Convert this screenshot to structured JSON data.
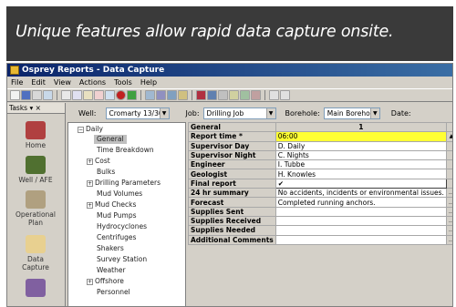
{
  "banner": {
    "caption": "Unique features allow rapid data capture onsite."
  },
  "window": {
    "title": "Osprey Reports - Data Capture"
  },
  "menu": [
    "File",
    "Edit",
    "View",
    "Actions",
    "Tools",
    "Help"
  ],
  "sidebar": {
    "header": "Tasks",
    "items": [
      {
        "label": "Home",
        "icon": "home-icon"
      },
      {
        "label": "Well / AFE",
        "icon": "well-icon"
      },
      {
        "label": "Operational Plan",
        "icon": "plan-icon"
      },
      {
        "label": "Data Capture",
        "icon": "data-capture-icon"
      },
      {
        "label": "",
        "icon": "report-icon"
      }
    ]
  },
  "filters": {
    "well_label": "Well:",
    "well_value": "Cromarty 13/30a",
    "job_label": "Job:",
    "job_value": "Drilling Job",
    "borehole_label": "Borehole:",
    "borehole_value": "Main Borehole",
    "date_label": "Date:"
  },
  "tree": {
    "root": "Daily",
    "items": [
      {
        "label": "General",
        "selected": true,
        "expandable": false
      },
      {
        "label": "Time Breakdown",
        "expandable": false
      },
      {
        "label": "Cost",
        "expandable": true
      },
      {
        "label": "Bulks",
        "expandable": false
      },
      {
        "label": "Drilling Parameters",
        "expandable": true
      },
      {
        "label": "Mud Volumes",
        "expandable": false
      },
      {
        "label": "Mud Checks",
        "expandable": true
      },
      {
        "label": "Mud Pumps",
        "expandable": false
      },
      {
        "label": "Hydrocyclones",
        "expandable": false
      },
      {
        "label": "Centrifuges",
        "expandable": false
      },
      {
        "label": "Shakers",
        "expandable": false
      },
      {
        "label": "Survey Station",
        "expandable": false
      },
      {
        "label": "Weather",
        "expandable": false
      },
      {
        "label": "Offshore",
        "expandable": true
      },
      {
        "label": "Personnel",
        "expandable": false
      }
    ]
  },
  "grid": {
    "header_label": "General",
    "header_col": "1",
    "rows": [
      {
        "label": "Report time *",
        "value": "06:00",
        "highlight": true
      },
      {
        "label": "Supervisor Day",
        "value": "D. Daily"
      },
      {
        "label": "Supervisor Night",
        "value": "C. Nights"
      },
      {
        "label": "Engineer",
        "value": "I. Tubbe"
      },
      {
        "label": "Geologist",
        "value": "H. Knowles"
      },
      {
        "label": "Final report",
        "value": "✔",
        "checkbox": true
      },
      {
        "label": "24 hr summary",
        "value": "No accidents, incidents or environmental issues."
      },
      {
        "label": "Forecast",
        "value": "Completed running anchors."
      },
      {
        "label": "Supplies Sent",
        "value": ""
      },
      {
        "label": "Supplies Received",
        "value": ""
      },
      {
        "label": "Supplies Needed",
        "value": ""
      },
      {
        "label": "Additional Comments",
        "value": ""
      }
    ]
  }
}
